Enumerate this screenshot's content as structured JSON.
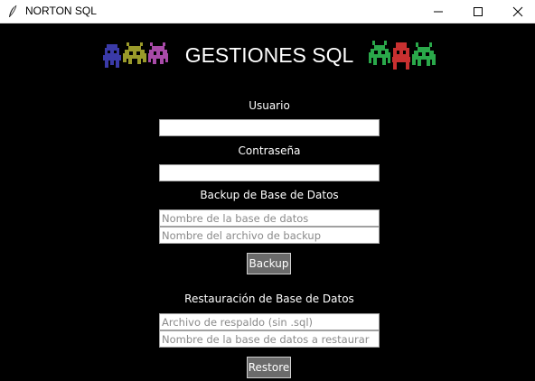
{
  "window": {
    "title": "NORTON SQL"
  },
  "header": {
    "title": "GESTIONES SQL"
  },
  "login": {
    "user_label": "Usuario",
    "user_value": "",
    "password_label": "Contraseña",
    "password_value": ""
  },
  "backup": {
    "section_title": "Backup de Base de Datos",
    "db_placeholder": "Nombre de la base de datos",
    "file_placeholder": "Nombre del archivo de backup",
    "button_label": "Backup"
  },
  "restore": {
    "section_title": "Restauración de Base de Datos",
    "file_placeholder": "Archivo de respaldo (sin .sql)",
    "db_placeholder": "Nombre de la base de datos a restaurar",
    "button_label": "Restore"
  },
  "icons": {
    "app": "feather-icon",
    "minimize": "minimize-icon",
    "maximize": "maximize-icon",
    "close": "close-icon",
    "left_sprites": "space-invaders-left-icon",
    "right_sprites": "space-invaders-right-icon"
  },
  "colors": {
    "background": "#000000",
    "text": "#ffffff",
    "button": "#6b6b6b",
    "invader_blue": "#3a3aa8",
    "invader_olive": "#9a9a2a",
    "invader_purple": "#a84aa8",
    "invader_green": "#2aa84a",
    "invader_red": "#c83030"
  }
}
